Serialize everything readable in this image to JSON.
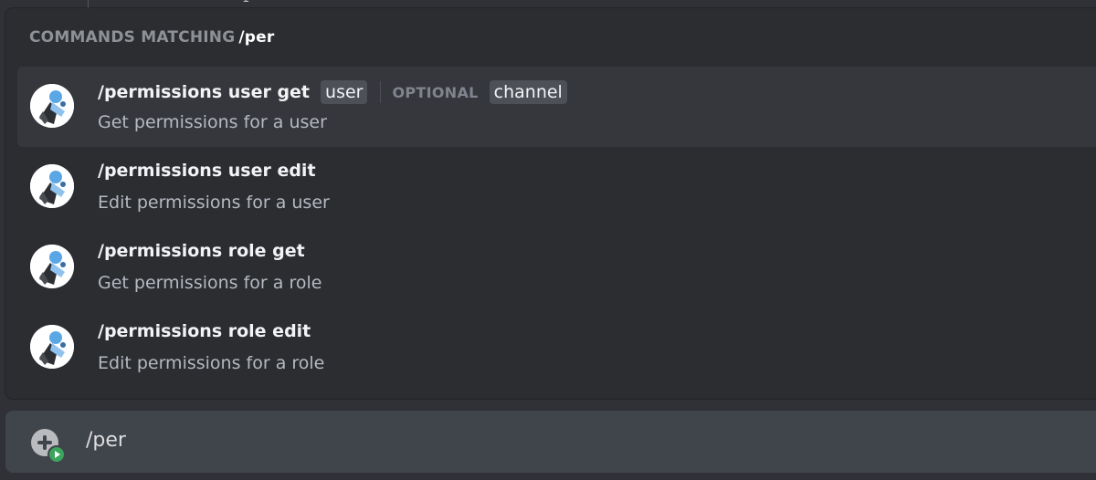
{
  "popup": {
    "header_label": "COMMANDS MATCHING",
    "header_query": "/per"
  },
  "commands": [
    {
      "title": "/permissions user get",
      "description": "Get permissions for a user",
      "selected": true,
      "required_param": "user",
      "optional_label": "OPTIONAL",
      "optional_param": "channel"
    },
    {
      "title": "/permissions user edit",
      "description": "Edit permissions for a user",
      "selected": false
    },
    {
      "title": "/permissions role get",
      "description": "Get permissions for a role",
      "selected": false
    },
    {
      "title": "/permissions role edit",
      "description": "Edit permissions for a role",
      "selected": false
    }
  ],
  "input": {
    "value": "/per"
  },
  "topbar": {
    "line_number": "1"
  },
  "icons": {
    "avatar": "bot-avatar-icon",
    "add": "plus-circle-icon",
    "badge": "play-badge-icon"
  },
  "colors": {
    "background": "#2f3136",
    "popup": "#2b2d31",
    "selected_row": "#35373c",
    "input_bar": "#40444b",
    "chip": "#4e5058",
    "badge_green": "#3ba55d"
  }
}
